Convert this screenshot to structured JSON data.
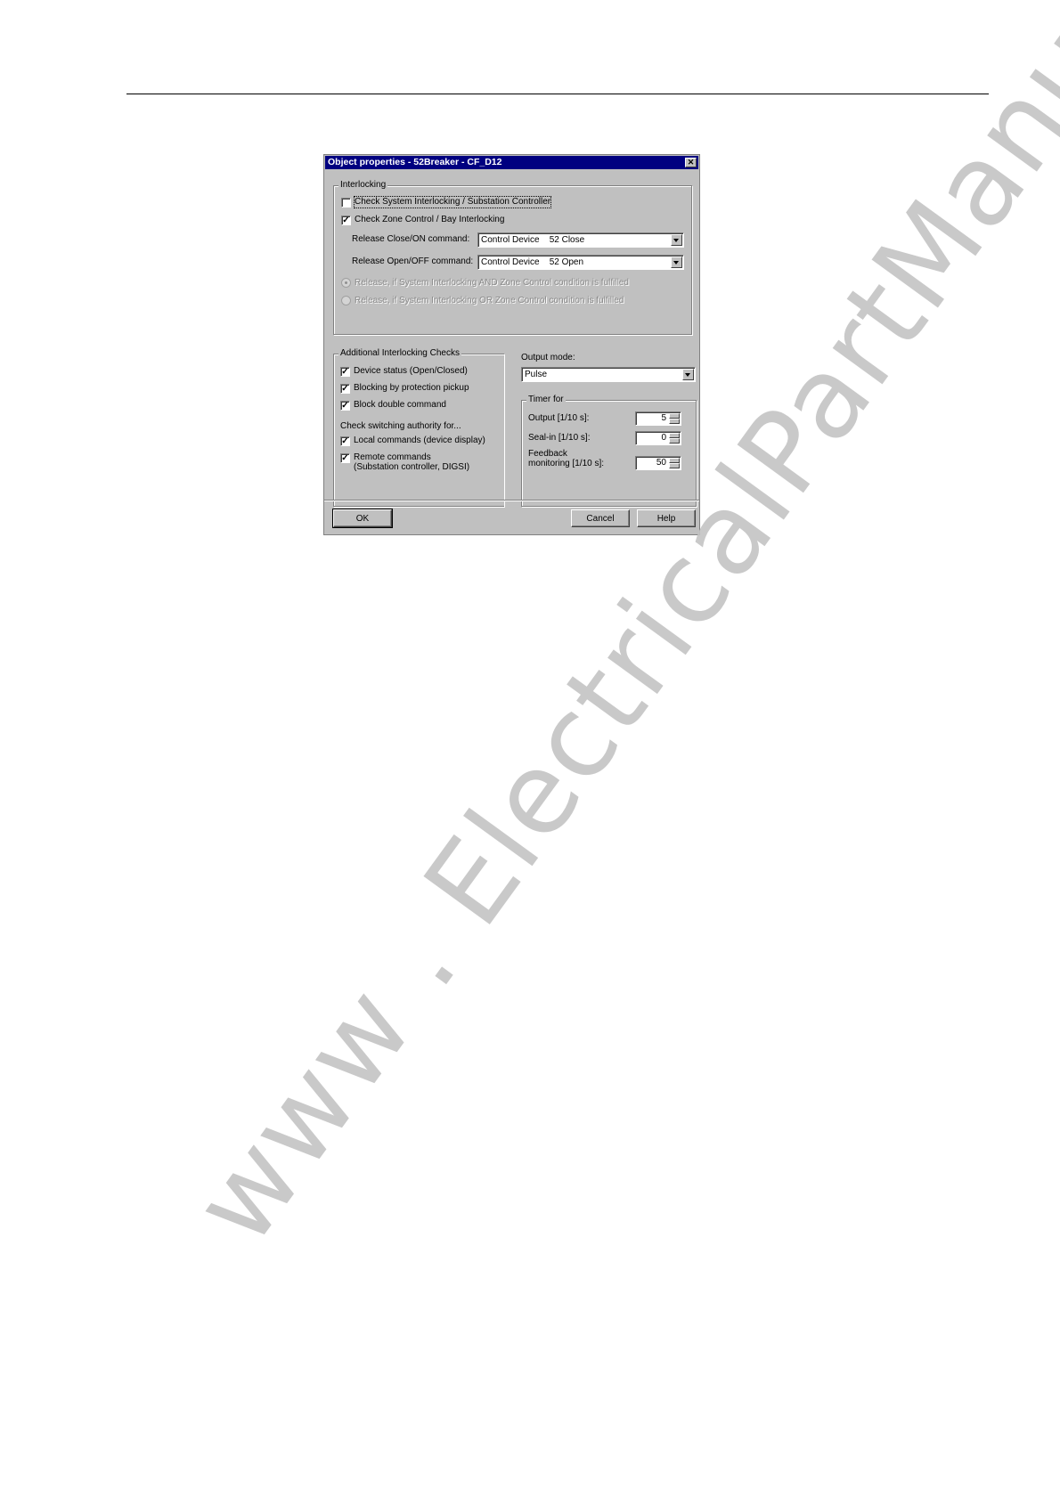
{
  "dialog": {
    "title": "Object properties - 52Breaker - CF_D12",
    "close_icon": "close-icon"
  },
  "interlocking": {
    "legend": "Interlocking",
    "check_system": {
      "label": "Check System Interlocking / Substation Controller",
      "checked": false
    },
    "check_zone": {
      "label": "Check Zone Control / Bay Interlocking",
      "checked": true
    },
    "release_close": {
      "label": "Release Close/ON command:",
      "value": "Control Device    52 Close"
    },
    "release_open": {
      "label": "Release Open/OFF command:",
      "value": "Control Device    52 Open"
    },
    "radio_and": {
      "label": "Release, if System Interlocking AND Zone Control condition is fulfilled",
      "selected": true,
      "disabled": true
    },
    "radio_or": {
      "label": "Release, if System Interlocking OR Zone Control condition is fulfilled",
      "selected": false,
      "disabled": true
    }
  },
  "additional": {
    "legend": "Additional Interlocking Checks",
    "device_status": {
      "label": "Device status (Open/Closed)",
      "checked": true
    },
    "blocking": {
      "label": "Blocking by protection pickup",
      "checked": true
    },
    "block_double": {
      "label": "Block double command",
      "checked": true
    },
    "authority_heading": "Check switching authority for...",
    "local": {
      "label": "Local commands (device display)",
      "checked": true
    },
    "remote": {
      "label_line1": "Remote commands",
      "label_line2": "(Substation controller, DIGSI)",
      "checked": true
    }
  },
  "output": {
    "mode_label": "Output mode:",
    "mode_value": "Pulse",
    "timer_legend": "Timer for",
    "output_timer": {
      "label": "Output [1/10 s]:",
      "value": "5"
    },
    "seal_in": {
      "label": "Seal-in [1/10 s]:",
      "value": "0"
    },
    "feedback": {
      "label_line1": "Feedback",
      "label_line2": "monitoring [1/10 s]:",
      "value": "50"
    }
  },
  "buttons": {
    "ok": "OK",
    "cancel": "Cancel",
    "help": "Help"
  },
  "watermark": "www . ElectricalPartManuals . com",
  "colors": {
    "titlebar": "#000080",
    "dialog_bg": "#c0c0c0",
    "watermark": "#c4c4c4"
  }
}
